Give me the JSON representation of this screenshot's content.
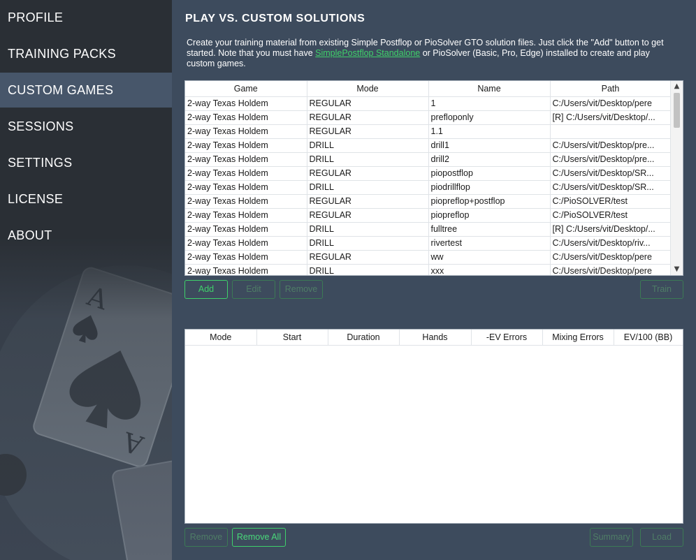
{
  "sidebar": {
    "items": [
      {
        "label": "PROFILE"
      },
      {
        "label": "TRAINING PACKS"
      },
      {
        "label": "CUSTOM GAMES"
      },
      {
        "label": "SESSIONS"
      },
      {
        "label": "SETTINGS"
      },
      {
        "label": "LICENSE"
      },
      {
        "label": "ABOUT"
      }
    ],
    "active_index": 2
  },
  "main": {
    "title": "PLAY VS. CUSTOM SOLUTIONS",
    "intro_before": "Create your training material from existing Simple Postflop or PioSolver GTO solution files. Just click the \"Add\" button to get started. Note that you must have ",
    "intro_link": "SimplePostflop Standalone",
    "intro_after": " or PioSolver (Basic, Pro, Edge) installed to create and play custom games."
  },
  "games_table": {
    "columns": [
      "Game",
      "Mode",
      "Name",
      "Path"
    ],
    "rows": [
      [
        "2-way Texas Holdem",
        "REGULAR",
        "1",
        "C:/Users/vit/Desktop/pere"
      ],
      [
        "2-way Texas Holdem",
        "REGULAR",
        "prefloponly",
        "[R] C:/Users/vit/Desktop/..."
      ],
      [
        "2-way Texas Holdem",
        "REGULAR",
        "1.1",
        ""
      ],
      [
        "2-way Texas Holdem",
        "DRILL",
        "drill1",
        "C:/Users/vit/Desktop/pre..."
      ],
      [
        "2-way Texas Holdem",
        "DRILL",
        "drill2",
        "C:/Users/vit/Desktop/pre..."
      ],
      [
        "2-way Texas Holdem",
        "REGULAR",
        "piopostflop",
        "C:/Users/vit/Desktop/SR..."
      ],
      [
        "2-way Texas Holdem",
        "DRILL",
        "piodrillflop",
        "C:/Users/vit/Desktop/SR..."
      ],
      [
        "2-way Texas Holdem",
        "REGULAR",
        "piopreflop+postflop",
        "C:/PioSOLVER/test"
      ],
      [
        "2-way Texas Holdem",
        "REGULAR",
        "piopreflop",
        "C:/PioSOLVER/test"
      ],
      [
        "2-way Texas Holdem",
        "DRILL",
        "fulltree",
        "[R] C:/Users/vit/Desktop/..."
      ],
      [
        "2-way Texas Holdem",
        "DRILL",
        "rivertest",
        "C:/Users/vit/Desktop/riv..."
      ],
      [
        "2-way Texas Holdem",
        "REGULAR",
        "ww",
        "C:/Users/vit/Desktop/pere"
      ],
      [
        "2-way Texas Holdem",
        "DRILL",
        "xxx",
        "C:/Users/vit/Desktop/pere"
      ]
    ]
  },
  "games_buttons": {
    "add": "Add",
    "edit": "Edit",
    "remove": "Remove",
    "train": "Train"
  },
  "sessions_table": {
    "columns": [
      "Mode",
      "Start",
      "Duration",
      "Hands",
      "-EV Errors",
      "Mixing Errors",
      "EV/100 (BB)"
    ]
  },
  "sessions_buttons": {
    "remove": "Remove",
    "remove_all": "Remove All",
    "summary": "Summary",
    "load": "Load"
  },
  "colors": {
    "accent": "#3fd16a",
    "sidebar_bg": "#2a2f35",
    "sidebar_active": "#47566a",
    "main_bg": "#3d4b5d"
  }
}
